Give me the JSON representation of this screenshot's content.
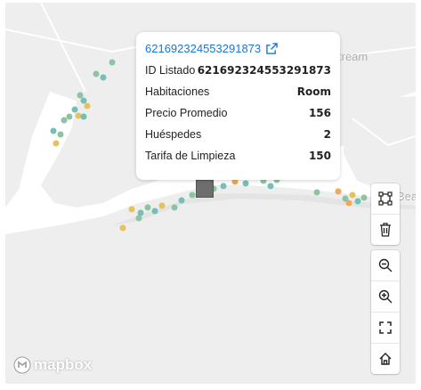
{
  "popup": {
    "title": "621692324553291873",
    "rows": [
      {
        "label": "ID Listado",
        "value": "621692324553291873"
      },
      {
        "label": "Habitaciones",
        "value": "Room"
      },
      {
        "label": "Precio Promedio",
        "value": "156"
      },
      {
        "label": "Huéspedes",
        "value": "2"
      },
      {
        "label": "Tarifa de Limpieza",
        "value": "150"
      }
    ]
  },
  "map": {
    "attribution": "mapbox",
    "label_stream": "tream",
    "label_bea": "Bea",
    "colors": {
      "water": "#ffffff",
      "land": "#eeeeee",
      "point_green": "#8dc3a0",
      "point_teal": "#74bfb8",
      "point_yellow": "#e6c25a",
      "point_orange": "#f0a85a"
    }
  },
  "controls": {
    "draw": [
      "polygon-select-icon",
      "trash-icon"
    ],
    "view": [
      "zoom-out-icon",
      "zoom-in-icon",
      "fullscreen-icon",
      "home-icon"
    ]
  }
}
